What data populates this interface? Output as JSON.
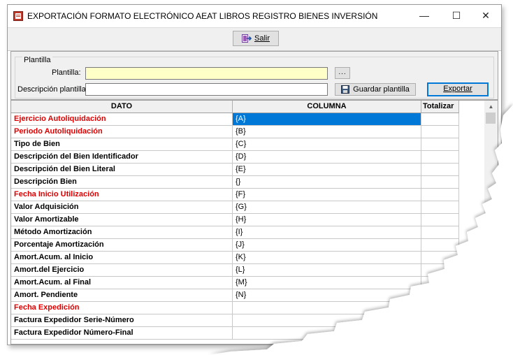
{
  "window": {
    "title": "EXPORTACIÓN FORMATO ELECTRÓNICO AEAT LIBROS REGISTRO BIENES INVERSIÓN",
    "minimize_glyph": "—",
    "maximize_glyph": "☐",
    "close_glyph": "✕",
    "app_icon": "app-document-icon"
  },
  "toolbar": {
    "salir_label": "Salir",
    "salir_icon": "exit-icon"
  },
  "plantilla": {
    "group_label": "Plantilla",
    "plantilla_label": "Plantilla:",
    "plantilla_value": "",
    "browse_label": "...",
    "descripcion_label": "Descripción plantilla",
    "descripcion_value": "",
    "guardar_label": "Guardar plantilla",
    "guardar_icon": "floppy-disk-icon",
    "exportar_label": "Exportar"
  },
  "grid": {
    "headers": [
      "DATO",
      "COLUMNA",
      "Totalizar"
    ],
    "rows": [
      {
        "dato": "Ejercicio Autoliquidación",
        "columna": "{A}",
        "required": true,
        "selected": true
      },
      {
        "dato": "Periodo Autoliquidación",
        "columna": "{B}",
        "required": true
      },
      {
        "dato": "Tipo de Bien",
        "columna": "{C}"
      },
      {
        "dato": "Descripción del Bien Identificador",
        "columna": "{D}"
      },
      {
        "dato": "Descripción del Bien Literal",
        "columna": "{E}"
      },
      {
        "dato": "Descripción Bien",
        "columna": "{}"
      },
      {
        "dato": "Fecha Inicio Utilización",
        "columna": "{F}",
        "required": true
      },
      {
        "dato": "Valor Adquisición",
        "columna": "{G}"
      },
      {
        "dato": "Valor Amortizable",
        "columna": "{H}"
      },
      {
        "dato": "Método Amortización",
        "columna": "{I}"
      },
      {
        "dato": "Porcentaje Amortización",
        "columna": "{J}"
      },
      {
        "dato": "Amort.Acum. al Inicio",
        "columna": "{K}"
      },
      {
        "dato": "Amort.del Ejercicio",
        "columna": "{L}"
      },
      {
        "dato": "Amort.Acum. al Final",
        "columna": "{M}"
      },
      {
        "dato": "Amort. Pendiente",
        "columna": "{N}"
      },
      {
        "dato": "Fecha Expedición",
        "columna": "",
        "required": true
      },
      {
        "dato": "Factura Expedidor Serie-Número",
        "columna": ""
      },
      {
        "dato": "Factura Expedidor Número-Final",
        "columna": ""
      }
    ]
  },
  "colors": {
    "required_text": "#e00000",
    "selection": "#0078d7",
    "input_yellow": "#ffffc8"
  }
}
